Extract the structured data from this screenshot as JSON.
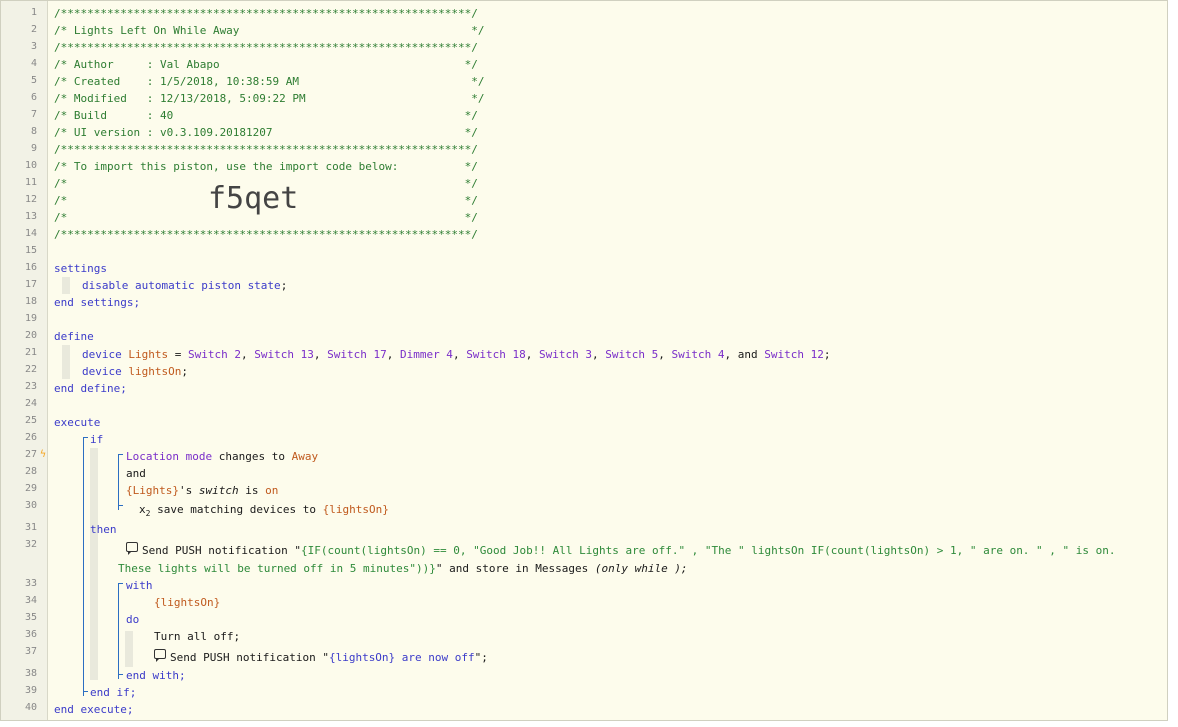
{
  "line_numbers": [
    "1",
    "2",
    "3",
    "4",
    "5",
    "6",
    "7",
    "8",
    "9",
    "10",
    "11",
    "12",
    "13",
    "14",
    "15",
    "16",
    "17",
    "18",
    "19",
    "20",
    "21",
    "22",
    "23",
    "24",
    "25",
    "26",
    "27",
    "28",
    "29",
    "30",
    "31",
    "32",
    "33",
    "34",
    "35",
    "36",
    "37",
    "38",
    "39",
    "40"
  ],
  "header": {
    "l1": "/**************************************************************/",
    "l2": "/* Lights Left On While Away                                   */",
    "l3": "/**************************************************************/",
    "l4": "/* Author     : Val Abapo                                     */",
    "l5": "/* Created    : 1/5/2018, 10:38:59 AM                          */",
    "l6": "/* Modified   : 12/13/2018, 5:09:22 PM                         */",
    "l7": "/* Build      : 40                                            */",
    "l8": "/* UI version : v0.3.109.20181207                             */",
    "l9": "/**************************************************************/",
    "l10": "/* To import this piston, use the import code below:          */",
    "l11": "/*                                                            */",
    "l12": "/*                                                            */",
    "l13": "/*                                                            */",
    "l14": "/**************************************************************/",
    "import_code": "f5qet"
  },
  "settings": {
    "open": "settings",
    "body_kw": "disable automatic piston state",
    "semi": ";",
    "close": "end settings;"
  },
  "define": {
    "open": "define",
    "device_kw": "device",
    "lights_var": "Lights",
    "equals": " = ",
    "devices": [
      "Switch 2",
      "Switch 13",
      "Switch 17",
      "Dimmer 4",
      "Switch 18",
      "Switch 3",
      "Switch 5",
      "Switch 4",
      "Switch 12"
    ],
    "and_word": "and",
    "lightson_var": "lightsOn",
    "close": "end define;"
  },
  "execute": {
    "open": "execute",
    "if_kw": "if",
    "cond1_attr": "Location mode",
    "cond1_op": " changes to ",
    "cond1_val": "Away",
    "and_kw": "and",
    "cond2_dev": "{Lights}",
    "cond2_poss": "'s ",
    "cond2_attr": "switch",
    "cond2_op": " is ",
    "cond2_val": "on",
    "save_mark": "x",
    "save_sub": "2",
    "save_text": "save matching devices to ",
    "save_var": "{lightsOn}",
    "then_kw": "then",
    "push1_pre": "Send PUSH notification \"",
    "push1_expr": "{IF(count(lightsOn) == 0, \"Good Job!! All Lights are off.\" , \"The \" lightsOn IF(count(lightsOn) > 1, \" are on. \" , \" is on.",
    "push1_expr2": "These lights will be turned off in 5 minutes\"))}",
    "push1_post": "\" and store in Messages ",
    "push1_only": "(only while );",
    "with_kw": "with",
    "with_var": "{lightsOn}",
    "do_kw": "do",
    "turn_off": "Turn all off;",
    "push2_pre": "Send PUSH notification \"",
    "push2_var": "{lightsOn}",
    "push2_text": " are now off",
    "push2_post": "\";",
    "end_with": "end with;",
    "end_if": "end if;",
    "close": "end execute;"
  },
  "colors": {
    "comment": "#2e7d32",
    "keyword": "#3b3bc9",
    "variable": "#c05a1e",
    "device": "#7a2ec9",
    "string": "#2e8a3a",
    "trigger_bolt": "#f5a623"
  }
}
